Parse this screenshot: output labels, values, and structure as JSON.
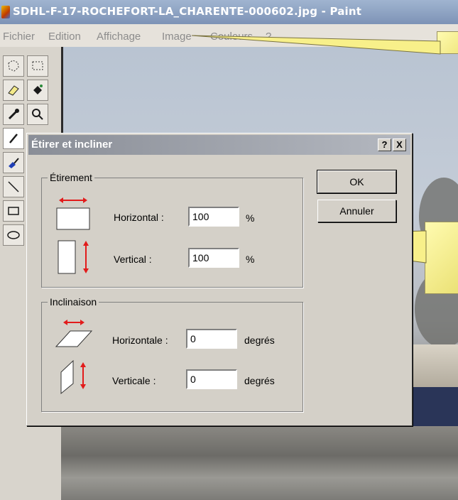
{
  "window": {
    "title": "SDHL-F-17-ROCHEFORT-LA_CHARENTE-000602.jpg - Paint",
    "app_icon": "paint-icon"
  },
  "menu": {
    "items": [
      "Fichier",
      "Edition",
      "Affichage",
      "Image",
      "Couleurs",
      "?"
    ]
  },
  "toolbox": {
    "tools": [
      "free-select-icon",
      "rect-select-icon",
      "eraser-icon",
      "fill-icon",
      "color-picker-icon",
      "magnifier-icon",
      "pencil-icon",
      "brush-icon",
      "line-icon",
      "rectangle-icon",
      "ellipse-icon"
    ]
  },
  "dialog": {
    "title": "Étirer et incliner",
    "help_button": "?",
    "close_button": "X",
    "stretch": {
      "group_label": "Étirement",
      "horizontal_label": "Horizontal :",
      "horizontal_value": "100",
      "horizontal_unit": "%",
      "vertical_label": "Vertical :",
      "vertical_value": "100",
      "vertical_unit": "%"
    },
    "skew": {
      "group_label": "Inclinaison",
      "horizontal_label": "Horizontale :",
      "horizontal_value": "0",
      "horizontal_unit": "degrés",
      "vertical_label": "Verticale :",
      "vertical_value": "0",
      "vertical_unit": "degrés"
    },
    "ok_label": "OK",
    "cancel_label": "Annuler"
  },
  "colors": {
    "title_bar": "#7d93b6",
    "dialog_face": "#d4d0c8",
    "callout": "#fffbb0",
    "arrow_red": "#e21b1b"
  }
}
